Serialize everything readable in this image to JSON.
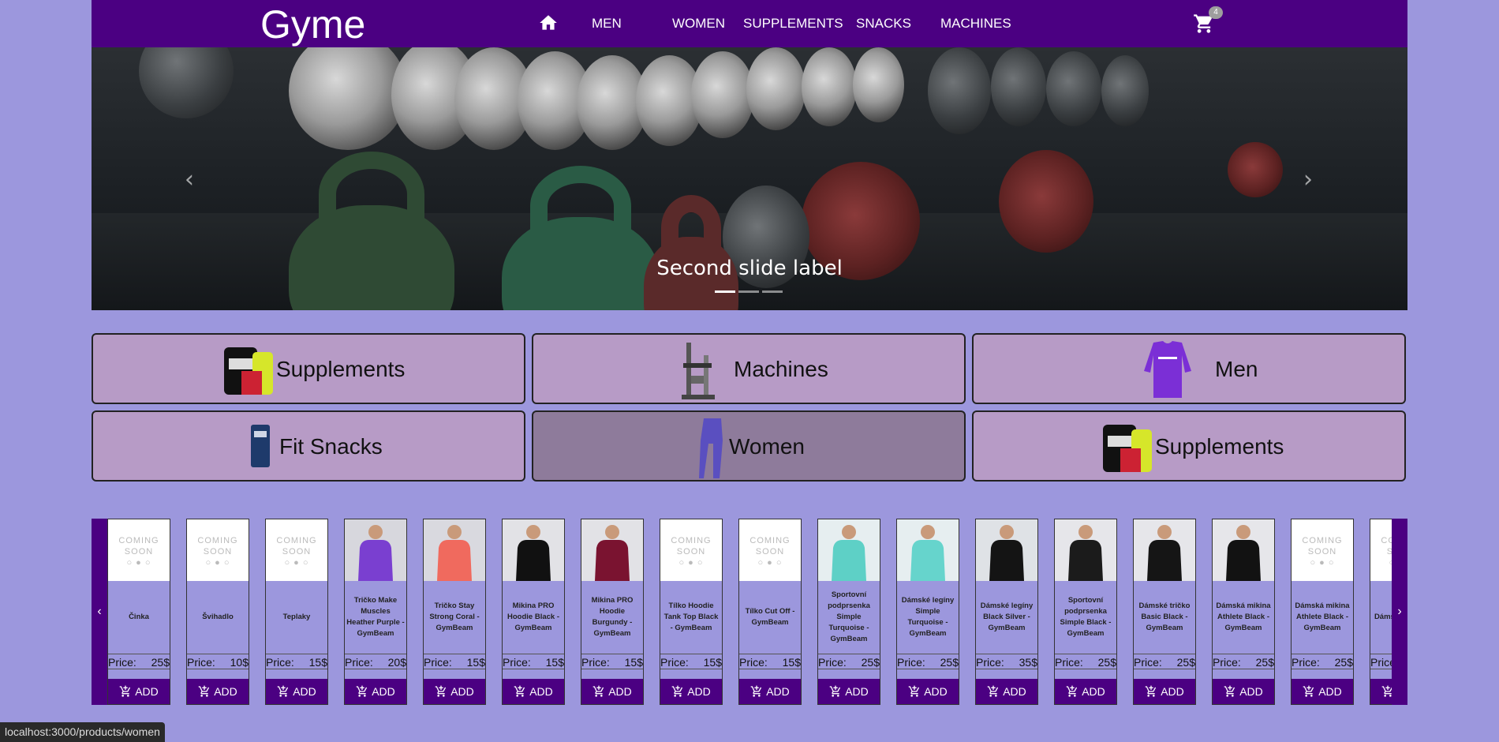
{
  "navbar": {
    "brand": "Gyme",
    "links": [
      "MEN",
      "WOMEN",
      "SUPPLEMENTS",
      "SNACKS",
      "MACHINES"
    ],
    "cart_count": "4"
  },
  "carousel": {
    "caption": "Second slide label",
    "prev_icon": "chevron-left-icon",
    "next_icon": "chevron-right-icon",
    "indicator_count": 3,
    "active_indicator": 0
  },
  "categories": [
    {
      "label": "Supplements",
      "icon": "supplements-image"
    },
    {
      "label": "Machines",
      "icon": "machine-image"
    },
    {
      "label": "Men",
      "icon": "shirt-image"
    },
    {
      "label": "Fit Snacks",
      "icon": "snack-bar-image"
    },
    {
      "label": "Women",
      "icon": "leggings-image"
    },
    {
      "label": "Supplements",
      "icon": "supplements-image"
    }
  ],
  "products": {
    "price_label": "Price:",
    "add_label": "ADD",
    "items": [
      {
        "name": "Činka",
        "price": "25$",
        "image": "coming-soon"
      },
      {
        "name": "Švihadlo",
        "price": "10$",
        "image": "coming-soon"
      },
      {
        "name": "Teplaky",
        "price": "15$",
        "image": "coming-soon"
      },
      {
        "name": "Tričko Make Muscles Heather Purple - GymBeam",
        "price": "20$",
        "image": "purple-tshirt"
      },
      {
        "name": "Tričko Stay Strong Coral - GymBeam",
        "price": "15$",
        "image": "coral-tshirt"
      },
      {
        "name": "Mikina PRO Hoodie Black - GymBeam",
        "price": "15$",
        "image": "black-hoodie"
      },
      {
        "name": "Mikina PRO Hoodie Burgundy - GymBeam",
        "price": "15$",
        "image": "burgundy-hoodie"
      },
      {
        "name": "Tílko Hoodie Tank Top Black - GymBeam",
        "price": "15$",
        "image": "coming-soon"
      },
      {
        "name": "Tílko Cut Off - GymBeam",
        "price": "15$",
        "image": "coming-soon"
      },
      {
        "name": "Sportovní podprsenka Simple Turquoise - GymBeam",
        "price": "25$",
        "image": "turquoise-bra"
      },
      {
        "name": "Dámské legíny Simple Turquoise - GymBeam",
        "price": "25$",
        "image": "turquoise-leggings"
      },
      {
        "name": "Dámské legíny Black Silver - GymBeam",
        "price": "35$",
        "image": "black-leggings"
      },
      {
        "name": "Sportovní podprsenka Simple Black - GymBeam",
        "price": "25$",
        "image": "black-bra"
      },
      {
        "name": "Dámské tričko Basic Black - GymBeam",
        "price": "25$",
        "image": "black-tshirt-women"
      },
      {
        "name": "Dámská mikina Athlete Black - GymBeam",
        "price": "25$",
        "image": "black-hoodie-women"
      },
      {
        "name": "Dámská mikina Athlete Black - GymBeam",
        "price": "25$",
        "image": "coming-soon"
      },
      {
        "name": "Dámské High...",
        "price": "",
        "image": "coming-soon"
      }
    ]
  },
  "coming_soon": {
    "line1": "COMING",
    "line2": "SOON"
  },
  "status_url": "localhost:3000/products/women"
}
